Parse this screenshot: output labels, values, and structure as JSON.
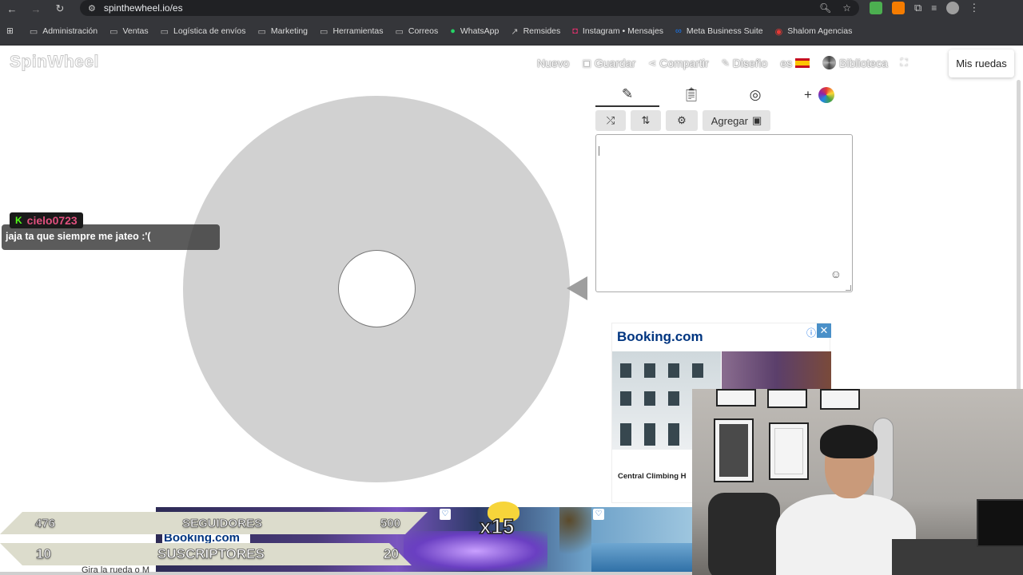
{
  "browser": {
    "url": "spinthewheel.io/es",
    "bookmarks": [
      {
        "label": "Administración",
        "icon": "folder-icon"
      },
      {
        "label": "Ventas",
        "icon": "folder-icon"
      },
      {
        "label": "Logística de envíos",
        "icon": "folder-icon"
      },
      {
        "label": "Marketing",
        "icon": "folder-icon"
      },
      {
        "label": "Herramientas",
        "icon": "folder-icon"
      },
      {
        "label": "Correos",
        "icon": "folder-icon"
      },
      {
        "label": "WhatsApp",
        "icon": "whatsapp-icon"
      },
      {
        "label": "Remsides",
        "icon": "link-icon"
      },
      {
        "label": "Instagram • Mensajes",
        "icon": "instagram-icon"
      },
      {
        "label": "Meta Business Suite",
        "icon": "meta-icon"
      },
      {
        "label": "Shalom Agencias",
        "icon": "shalom-icon"
      }
    ]
  },
  "app": {
    "logo": "SpinWheel",
    "nav": {
      "new": "Nuevo",
      "save": "Guardar",
      "share": "Compartir",
      "design": "Diseño",
      "lang": "es",
      "library": "Biblioteca",
      "my_wheels": "Mis ruedas"
    },
    "panel": {
      "add_label": "Agregar",
      "entries_text": ""
    },
    "wheel": {
      "color": "#d1d1d1",
      "pointer_color": "#9e9e9e"
    }
  },
  "chat": {
    "username": "cielo0723",
    "message": "jaja ta que siempre me jateo :'("
  },
  "ad": {
    "brand": "Booking.com",
    "caption": "Central Climbing H"
  },
  "stream_overlay": {
    "followers_current": "476",
    "followers_label": "SEGUIDORES",
    "followers_goal": "500",
    "subs_current": "10",
    "subs_label": "SUSCRIPTORES",
    "subs_goal": "20",
    "multiplier": "x15",
    "booking_small": "Booking.com",
    "bottom_hint": "Gira la rueda o M"
  },
  "colors": {
    "accent_logo_stroke": "#c8c8c8",
    "chat_name": "#e0507e",
    "kick_green": "#53fc18",
    "booking_blue": "#003580"
  }
}
